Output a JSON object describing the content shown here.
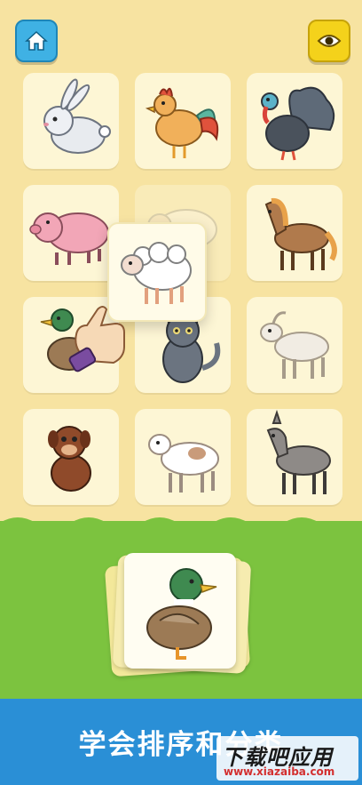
{
  "toolbar": {
    "home_icon": "home-icon",
    "eye_icon": "eye-icon"
  },
  "grid": {
    "cards": [
      "rabbit",
      "rooster",
      "turkey",
      "pig",
      "sheep",
      "horse",
      "duck",
      "cat",
      "goat",
      "dog",
      "cow",
      "donkey"
    ],
    "empty_slot": "sheep"
  },
  "dragging": {
    "animal": "sheep"
  },
  "deck": {
    "top_card": "duck"
  },
  "colors": {
    "background": "#f7e3a1",
    "grass": "#7cc33f",
    "banner": "#2a8fd6"
  },
  "banner": {
    "text": "学会排序和分类"
  },
  "watermark": {
    "title": "下载吧应用",
    "url": "www.xiazaiba.com"
  }
}
